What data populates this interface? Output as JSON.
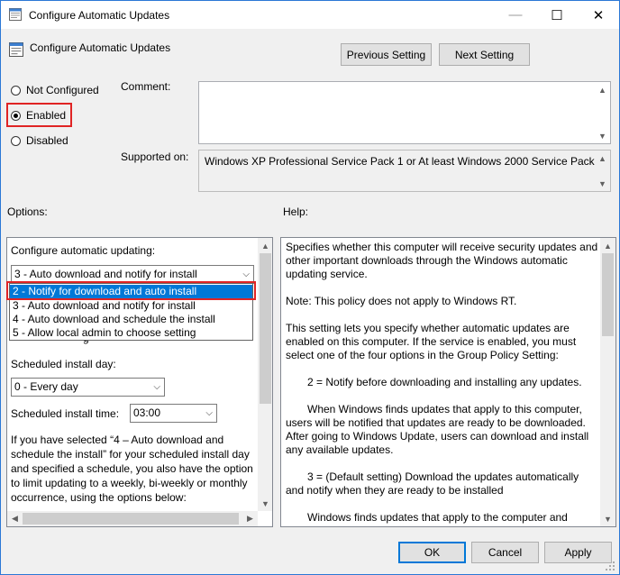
{
  "window": {
    "title": "Configure Automatic Updates",
    "controls": {
      "minimize": "—",
      "maximize": "☐",
      "close": "✕"
    }
  },
  "header": {
    "policy_name": "Configure Automatic Updates",
    "previous_label": "Previous Setting",
    "next_label": "Next Setting"
  },
  "state": {
    "not_configured_label": "Not Configured",
    "enabled_label": "Enabled",
    "disabled_label": "Disabled",
    "selected": "Enabled"
  },
  "comment": {
    "label": "Comment:",
    "value": ""
  },
  "supported": {
    "label": "Supported on:",
    "value": "Windows XP Professional Service Pack 1 or At least Windows 2000 Service Pack 3"
  },
  "options": {
    "label": "Options:",
    "configure_label": "Configure automatic updating:",
    "configure_value": "3 - Auto download and notify for install",
    "dropdown_options": [
      "2 - Notify for download and auto install",
      "3 - Auto download and notify for install",
      "4 - Auto download and schedule the install",
      "5 - Allow local admin to choose setting"
    ],
    "highlighted_option": "2 - Notify for download and auto install",
    "hidden_fragment": "g",
    "day_label": "Scheduled install day:",
    "day_value": "0 - Every day",
    "time_label": "Scheduled install time:",
    "time_value": "03:00",
    "note_lines": [
      "If you have selected “4 – Auto download and",
      "schedule the install” for your scheduled install day",
      "and specified a schedule, you also have the option",
      "to limit updating to a weekly, bi-weekly or monthly",
      "occurrence, using the options below:"
    ]
  },
  "help": {
    "label": "Help:",
    "paragraphs": [
      "Specifies whether this computer will receive security updates and other important downloads through the Windows automatic updating service.",
      "Note: This policy does not apply to Windows RT.",
      "This setting lets you specify whether automatic updates are enabled on this computer. If the service is enabled, you must select one of the four options in the Group Policy Setting:",
      "2 = Notify before downloading and installing any updates.",
      "When Windows finds updates that apply to this computer, users will be notified that updates are ready to be downloaded. After going to Windows Update, users can download and install any available updates.",
      "3 = (Default setting) Download the updates automatically and notify when they are ready to be installed",
      "Windows finds updates that apply to the computer and"
    ]
  },
  "footer": {
    "ok_label": "OK",
    "cancel_label": "Cancel",
    "apply_label": "Apply"
  },
  "colors": {
    "highlight": "#0078d7",
    "annotation": "#e02424",
    "border": "#2b78d6"
  }
}
